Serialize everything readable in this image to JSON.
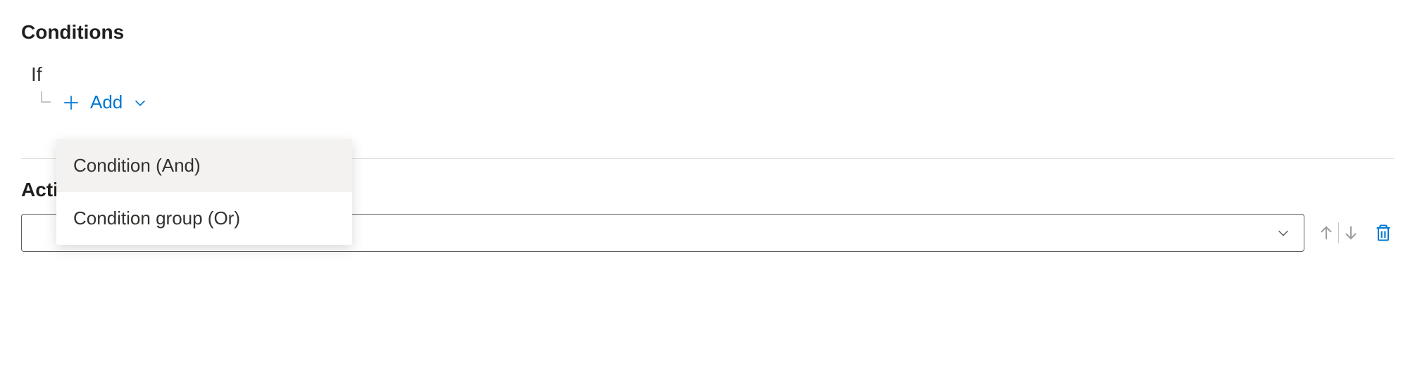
{
  "conditions": {
    "heading": "Conditions",
    "if_label": "If",
    "add_label": "Add",
    "menu": {
      "items": [
        {
          "label": "Condition (And)"
        },
        {
          "label": "Condition group (Or)"
        }
      ]
    }
  },
  "actions": {
    "heading": "Actions",
    "select_value": ""
  },
  "colors": {
    "link": "#0078d4",
    "icon_disabled": "#a19f9d",
    "icon_enabled": "#605e5c"
  }
}
